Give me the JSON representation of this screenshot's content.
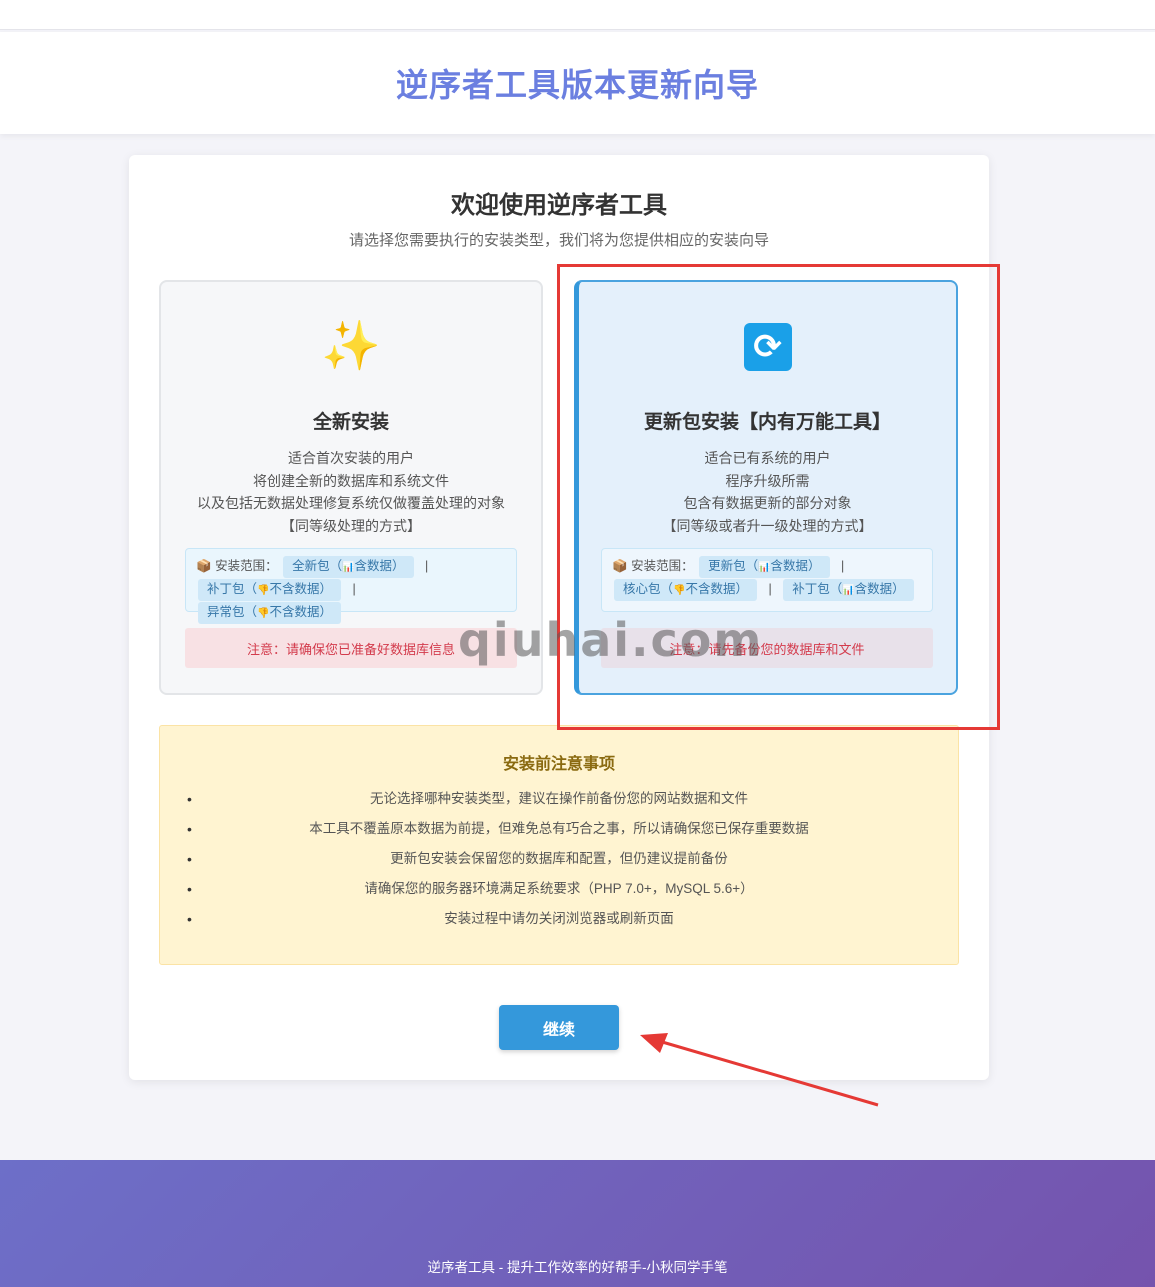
{
  "header": {
    "title": "逆序者工具版本更新向导"
  },
  "welcome": {
    "title": "欢迎使用逆序者工具",
    "subtitle": "请选择您需要执行的安装类型，我们将为您提供相应的安装向导"
  },
  "options": [
    {
      "icon": "sparkles-icon",
      "icon_glyph": "✨",
      "title": "全新安装",
      "desc": [
        "适合首次安装的用户",
        "将创建全新的数据库和系统文件",
        "以及包括无数据处理修复系统仅做覆盖处理的对象",
        "【同等级处理的方式】"
      ],
      "scope_label": "安装范围：",
      "tags": [
        "全新包（",
        "含数据）",
        "补丁包（",
        "不含数据）",
        "异常包（",
        "不含数据）"
      ],
      "separator": "|",
      "notice": "注意：请确保您已准备好数据库信息"
    },
    {
      "icon": "refresh-icon",
      "icon_glyph": "🔄",
      "title": "更新包安装【内有万能工具】",
      "desc": [
        "适合已有系统的用户",
        "程序升级所需",
        "包含有数据更新的部分对象",
        "【同等级或者升一级处理的方式】"
      ],
      "scope_label": "安装范围：",
      "tags": [
        "更新包（",
        "含数据）",
        "核心包（",
        "不含数据）",
        "补丁包（",
        "含数据）"
      ],
      "separator": "|",
      "notice": "注意：请先备份您的数据库和文件"
    }
  ],
  "warnings": {
    "title": "安装前注意事项",
    "items": [
      "无论选择哪种安装类型，建议在操作前备份您的网站数据和文件",
      "本工具不覆盖原本数据为前提，但难免总有巧合之事，所以请确保您已保存重要数据",
      "更新包安装会保留您的数据库和配置，但仍建议提前备份",
      "请确保您的服务器环境满足系统要求（PHP 7.0+，MySQL 5.6+）",
      "安装过程中请勿关闭浏览器或刷新页面"
    ]
  },
  "continue_label": "继续",
  "watermark": "qiuhai.com",
  "footer": {
    "text": "逆序者工具 - 提升工作效率的好帮手-小秋同学手笔"
  },
  "colors": {
    "accent": "#3498db",
    "title": "#6b7fe0",
    "notice": "#d33b4c",
    "warn_bg": "#fff4d1",
    "footer_start": "#6d6fc8",
    "footer_end": "#7553ad"
  }
}
